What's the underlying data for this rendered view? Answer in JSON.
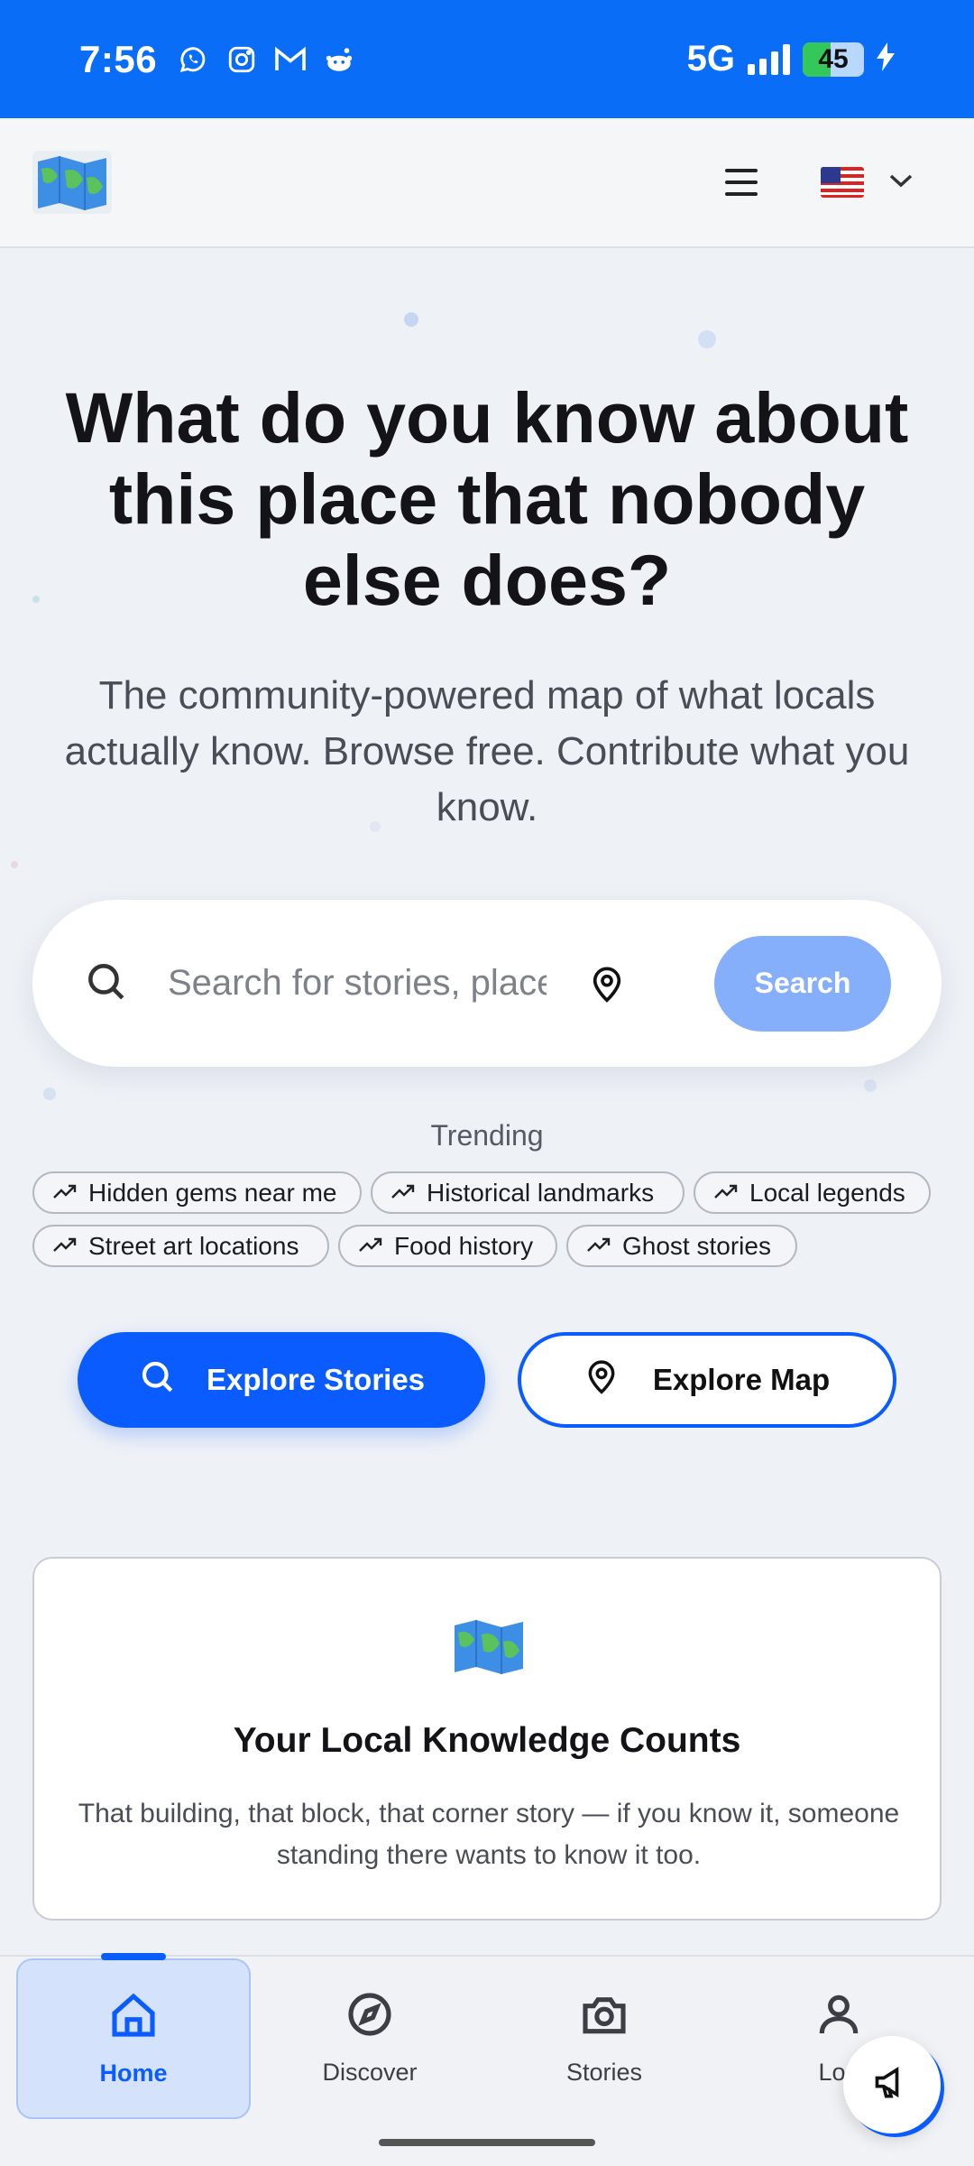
{
  "status_bar": {
    "time": "7:56",
    "network": "5G",
    "battery": "45",
    "battery_level": 0.45,
    "icons": [
      "whatsapp-icon",
      "instagram-icon",
      "gmail-icon",
      "reddit-icon"
    ]
  },
  "header": {
    "logo": "map-logo-icon",
    "menu_icon": "hamburger-menu-icon",
    "language_flag": "us-flag-icon",
    "language_chevron": "chevron-down-icon"
  },
  "hero": {
    "title": "What do you know about this place that nobody else does?",
    "subtitle": "The community-powered map of what locals actually know. Browse free. Contribute what you know."
  },
  "search": {
    "placeholder": "Search for stories, places, legends...",
    "button_label": "Search"
  },
  "trending": {
    "label": "Trending",
    "items": [
      "Hidden gems near me",
      "Historical landmarks",
      "Local legends",
      "Street art locations",
      "Food history",
      "Ghost stories"
    ]
  },
  "cta": {
    "explore_stories": "Explore Stories",
    "explore_map": "Explore Map"
  },
  "card": {
    "title": "Your Local Knowledge Counts",
    "text": "That building, that block, that corner story — if you know it, someone standing there wants to know it too."
  },
  "bottom_nav": {
    "items": [
      {
        "label": "Home",
        "icon": "home-icon",
        "active": true
      },
      {
        "label": "Discover",
        "icon": "compass-icon",
        "active": false
      },
      {
        "label": "Stories",
        "icon": "camera-icon",
        "active": false
      },
      {
        "label": "Log",
        "icon": "user-icon",
        "active": false
      }
    ]
  },
  "colors": {
    "status_bar": "#0a6df7",
    "primary": "#0b5cff",
    "search_button": "#85aefb",
    "background": "#eef1f6"
  }
}
